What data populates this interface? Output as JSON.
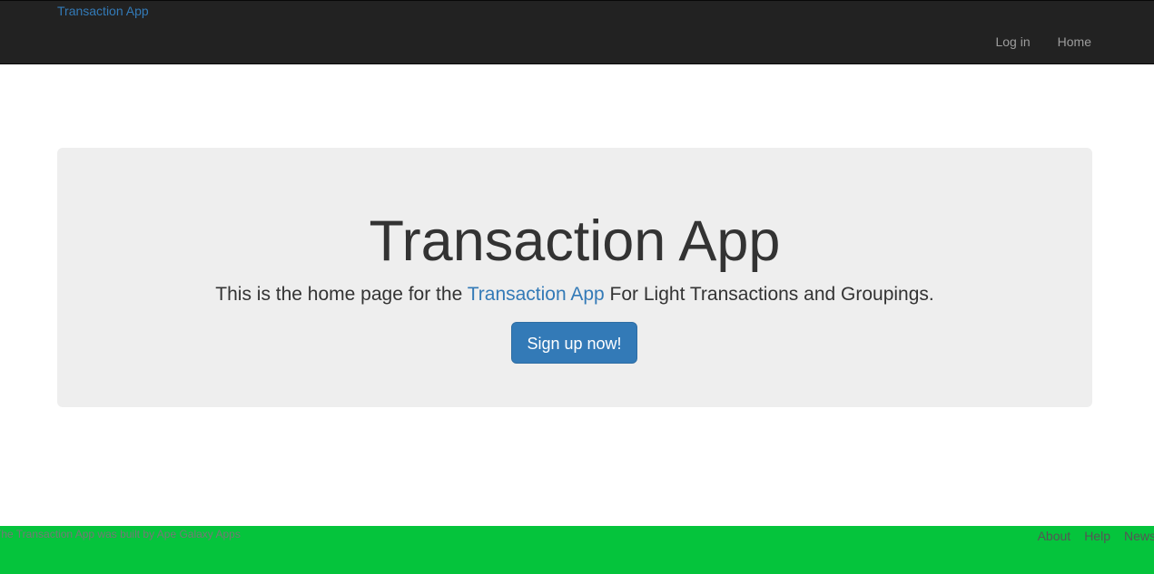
{
  "navbar": {
    "brand": "Transaction App",
    "links": [
      {
        "label": "Log in"
      },
      {
        "label": "Home"
      }
    ]
  },
  "hero": {
    "title": "Transaction App",
    "subtitle_before": "This is the home page for the ",
    "subtitle_link": "Transaction App",
    "subtitle_after": " For Light Transactions and Groupings.",
    "cta_label": "Sign up now!"
  },
  "footer": {
    "credit": "The Transaction App was built by Ape Galaxy Apps",
    "links": [
      {
        "label": "About"
      },
      {
        "label": "Help"
      },
      {
        "label": "News"
      }
    ]
  },
  "colors": {
    "navbar_bg": "#222222",
    "link": "#337ab7",
    "primary_button": "#337ab7",
    "jumbotron_bg": "#eeeeee",
    "footer_bg": "#05c43c"
  }
}
